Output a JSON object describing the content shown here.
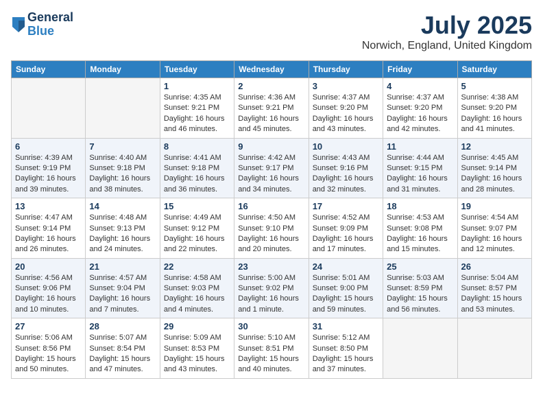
{
  "logo": {
    "general": "General",
    "blue": "Blue"
  },
  "title": "July 2025",
  "subtitle": "Norwich, England, United Kingdom",
  "weekdays": [
    "Sunday",
    "Monday",
    "Tuesday",
    "Wednesday",
    "Thursday",
    "Friday",
    "Saturday"
  ],
  "weeks": [
    [
      {
        "day": "",
        "info": ""
      },
      {
        "day": "",
        "info": ""
      },
      {
        "day": "1",
        "info": "Sunrise: 4:35 AM\nSunset: 9:21 PM\nDaylight: 16 hours and 46 minutes."
      },
      {
        "day": "2",
        "info": "Sunrise: 4:36 AM\nSunset: 9:21 PM\nDaylight: 16 hours and 45 minutes."
      },
      {
        "day": "3",
        "info": "Sunrise: 4:37 AM\nSunset: 9:20 PM\nDaylight: 16 hours and 43 minutes."
      },
      {
        "day": "4",
        "info": "Sunrise: 4:37 AM\nSunset: 9:20 PM\nDaylight: 16 hours and 42 minutes."
      },
      {
        "day": "5",
        "info": "Sunrise: 4:38 AM\nSunset: 9:20 PM\nDaylight: 16 hours and 41 minutes."
      }
    ],
    [
      {
        "day": "6",
        "info": "Sunrise: 4:39 AM\nSunset: 9:19 PM\nDaylight: 16 hours and 39 minutes."
      },
      {
        "day": "7",
        "info": "Sunrise: 4:40 AM\nSunset: 9:18 PM\nDaylight: 16 hours and 38 minutes."
      },
      {
        "day": "8",
        "info": "Sunrise: 4:41 AM\nSunset: 9:18 PM\nDaylight: 16 hours and 36 minutes."
      },
      {
        "day": "9",
        "info": "Sunrise: 4:42 AM\nSunset: 9:17 PM\nDaylight: 16 hours and 34 minutes."
      },
      {
        "day": "10",
        "info": "Sunrise: 4:43 AM\nSunset: 9:16 PM\nDaylight: 16 hours and 32 minutes."
      },
      {
        "day": "11",
        "info": "Sunrise: 4:44 AM\nSunset: 9:15 PM\nDaylight: 16 hours and 31 minutes."
      },
      {
        "day": "12",
        "info": "Sunrise: 4:45 AM\nSunset: 9:14 PM\nDaylight: 16 hours and 28 minutes."
      }
    ],
    [
      {
        "day": "13",
        "info": "Sunrise: 4:47 AM\nSunset: 9:14 PM\nDaylight: 16 hours and 26 minutes."
      },
      {
        "day": "14",
        "info": "Sunrise: 4:48 AM\nSunset: 9:13 PM\nDaylight: 16 hours and 24 minutes."
      },
      {
        "day": "15",
        "info": "Sunrise: 4:49 AM\nSunset: 9:12 PM\nDaylight: 16 hours and 22 minutes."
      },
      {
        "day": "16",
        "info": "Sunrise: 4:50 AM\nSunset: 9:10 PM\nDaylight: 16 hours and 20 minutes."
      },
      {
        "day": "17",
        "info": "Sunrise: 4:52 AM\nSunset: 9:09 PM\nDaylight: 16 hours and 17 minutes."
      },
      {
        "day": "18",
        "info": "Sunrise: 4:53 AM\nSunset: 9:08 PM\nDaylight: 16 hours and 15 minutes."
      },
      {
        "day": "19",
        "info": "Sunrise: 4:54 AM\nSunset: 9:07 PM\nDaylight: 16 hours and 12 minutes."
      }
    ],
    [
      {
        "day": "20",
        "info": "Sunrise: 4:56 AM\nSunset: 9:06 PM\nDaylight: 16 hours and 10 minutes."
      },
      {
        "day": "21",
        "info": "Sunrise: 4:57 AM\nSunset: 9:04 PM\nDaylight: 16 hours and 7 minutes."
      },
      {
        "day": "22",
        "info": "Sunrise: 4:58 AM\nSunset: 9:03 PM\nDaylight: 16 hours and 4 minutes."
      },
      {
        "day": "23",
        "info": "Sunrise: 5:00 AM\nSunset: 9:02 PM\nDaylight: 16 hours and 1 minute."
      },
      {
        "day": "24",
        "info": "Sunrise: 5:01 AM\nSunset: 9:00 PM\nDaylight: 15 hours and 59 minutes."
      },
      {
        "day": "25",
        "info": "Sunrise: 5:03 AM\nSunset: 8:59 PM\nDaylight: 15 hours and 56 minutes."
      },
      {
        "day": "26",
        "info": "Sunrise: 5:04 AM\nSunset: 8:57 PM\nDaylight: 15 hours and 53 minutes."
      }
    ],
    [
      {
        "day": "27",
        "info": "Sunrise: 5:06 AM\nSunset: 8:56 PM\nDaylight: 15 hours and 50 minutes."
      },
      {
        "day": "28",
        "info": "Sunrise: 5:07 AM\nSunset: 8:54 PM\nDaylight: 15 hours and 47 minutes."
      },
      {
        "day": "29",
        "info": "Sunrise: 5:09 AM\nSunset: 8:53 PM\nDaylight: 15 hours and 43 minutes."
      },
      {
        "day": "30",
        "info": "Sunrise: 5:10 AM\nSunset: 8:51 PM\nDaylight: 15 hours and 40 minutes."
      },
      {
        "day": "31",
        "info": "Sunrise: 5:12 AM\nSunset: 8:50 PM\nDaylight: 15 hours and 37 minutes."
      },
      {
        "day": "",
        "info": ""
      },
      {
        "day": "",
        "info": ""
      }
    ]
  ]
}
